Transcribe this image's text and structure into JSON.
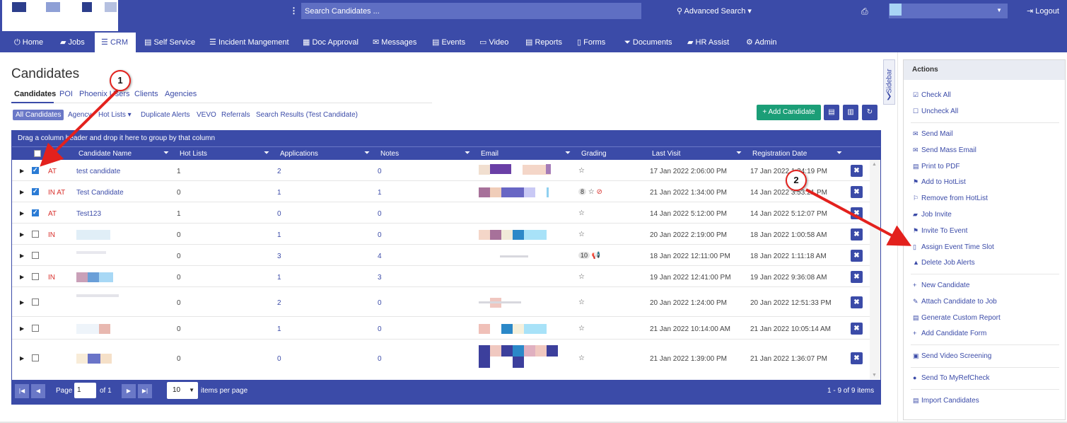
{
  "header": {
    "search_placeholder": "Search Candidates ...",
    "search_glyph": "⋮",
    "advanced_search": "Advanced Search",
    "logout": "Logout"
  },
  "nav": [
    {
      "label": "Home",
      "icon": "⏻"
    },
    {
      "label": "Jobs",
      "icon": "▰"
    },
    {
      "label": "CRM",
      "icon": "☰"
    },
    {
      "label": "Self Service",
      "icon": "▤"
    },
    {
      "label": "Incident Mangement",
      "icon": "☰"
    },
    {
      "label": "Doc Approval",
      "icon": "▦"
    },
    {
      "label": "Messages",
      "icon": "✉"
    },
    {
      "label": "Events",
      "icon": "▤"
    },
    {
      "label": "Video",
      "icon": "▭"
    },
    {
      "label": "Reports",
      "icon": "▤"
    },
    {
      "label": "Forms",
      "icon": "▯"
    },
    {
      "label": "Documents",
      "icon": "⏷"
    },
    {
      "label": "HR Assist",
      "icon": "▰"
    },
    {
      "label": "Admin",
      "icon": "⚙"
    }
  ],
  "page": {
    "title": "Candidates",
    "tabs": [
      "Candidates",
      "POI",
      "Phoenix Users",
      "Clients",
      "Agencies"
    ],
    "subtabs": [
      "All Candidates",
      "Agency",
      "Hot Lists ▾",
      "Duplicate Alerts",
      "VEVO",
      "Referrals",
      "Search Results (Test Candidate)"
    ],
    "add_candidate": "+ Add Candidate"
  },
  "grid": {
    "group_hint": "Drag a column header and drop it here to group by that column",
    "columns": [
      "Candidate Name",
      "Hot Lists",
      "Applications",
      "Notes",
      "Email",
      "Grading",
      "Last Visit",
      "Registration Date"
    ],
    "rows": [
      {
        "checked": true,
        "tag": "AT",
        "name": "test candidate",
        "hot": "1",
        "apps": "2",
        "notes": "0",
        "grade_count": "",
        "grade_extra": "",
        "last": "17 Jan 2022 2:06:00 PM",
        "reg": "17 Jan 2022 1:34:19 PM"
      },
      {
        "checked": true,
        "tag": "IN AT",
        "name": "Test Candidate",
        "hot": "0",
        "apps": "1",
        "notes": "1",
        "grade_count": "8",
        "grade_extra": "⊘",
        "last": "21 Jan 2022 1:34:00 PM",
        "reg": "14 Jan 2022 3:53:21 PM"
      },
      {
        "checked": true,
        "tag": "AT",
        "name": "Test123",
        "hot": "1",
        "apps": "0",
        "notes": "0",
        "grade_count": "",
        "grade_extra": "",
        "last": "14 Jan 2022 5:12:00 PM",
        "reg": "14 Jan 2022 5:12:07 PM"
      },
      {
        "checked": false,
        "tag": "IN",
        "name": "",
        "hot": "0",
        "apps": "1",
        "notes": "0",
        "grade_count": "",
        "grade_extra": "",
        "last": "20 Jan 2022 2:19:00 PM",
        "reg": "18 Jan 2022 1:00:58 AM"
      },
      {
        "checked": false,
        "tag": "",
        "name": "",
        "hot": "0",
        "apps": "3",
        "notes": "4",
        "grade_count": "10",
        "grade_extra": "📢",
        "last": "18 Jan 2022 12:11:00 PM",
        "reg": "18 Jan 2022 1:11:18 AM"
      },
      {
        "checked": false,
        "tag": "IN",
        "name": "",
        "hot": "0",
        "apps": "1",
        "notes": "3",
        "grade_count": "",
        "grade_extra": "",
        "last": "19 Jan 2022 12:41:00 PM",
        "reg": "19 Jan 2022 9:36:08 AM"
      },
      {
        "checked": false,
        "tag": "",
        "name": "",
        "hot": "0",
        "apps": "2",
        "notes": "0",
        "grade_count": "",
        "grade_extra": "",
        "last": "20 Jan 2022 1:24:00 PM",
        "reg": "20 Jan 2022 12:51:33 PM"
      },
      {
        "checked": false,
        "tag": "",
        "name": "",
        "hot": "0",
        "apps": "1",
        "notes": "0",
        "grade_count": "",
        "grade_extra": "",
        "last": "21 Jan 2022 10:14:00 AM",
        "reg": "21 Jan 2022 10:05:14 AM"
      },
      {
        "checked": false,
        "tag": "",
        "name": "",
        "hot": "0",
        "apps": "0",
        "notes": "0",
        "grade_count": "",
        "grade_extra": "",
        "last": "21 Jan 2022 1:39:00 PM",
        "reg": "21 Jan 2022 1:36:07 PM"
      }
    ],
    "pager": {
      "page_label": "Page",
      "page": "1",
      "of": "of 1",
      "per_page": "10",
      "per_page_label": "items per page",
      "summary": "1 - 9 of 9 items"
    }
  },
  "sidebar_toggle": "Sidebar",
  "actions": {
    "title": "Actions",
    "items": [
      {
        "label": "Check All",
        "icon": "☑"
      },
      {
        "label": "Uncheck All",
        "icon": "☐"
      },
      {
        "label": "Send Mail",
        "icon": "✉"
      },
      {
        "label": "Send Mass Email",
        "icon": "✉"
      },
      {
        "label": "Print to PDF",
        "icon": "▤"
      },
      {
        "label": "Add to HotList",
        "icon": "⚑"
      },
      {
        "label": "Remove from HotList",
        "icon": "⚐"
      },
      {
        "label": "Job Invite",
        "icon": "▰"
      },
      {
        "label": "Invite To Event",
        "icon": "⚑"
      },
      {
        "label": "Assign Event Time Slot",
        "icon": "▯"
      },
      {
        "label": "Delete Job Alerts",
        "icon": "▲"
      },
      {
        "label": "New Candidate",
        "icon": "+"
      },
      {
        "label": "Attach Candidate to Job",
        "icon": "✎"
      },
      {
        "label": "Generate Custom Report",
        "icon": "▤"
      },
      {
        "label": "Add Candidate Form",
        "icon": "+"
      },
      {
        "label": "Send Video Screening",
        "icon": "▣"
      },
      {
        "label": "Send To MyRefCheck",
        "icon": "●"
      },
      {
        "label": "Import Candidates",
        "icon": "▤"
      }
    ]
  },
  "annotations": [
    "1",
    "2"
  ],
  "colors": {
    "primary": "#3b4ba8",
    "success": "#1b9e77",
    "danger": "#d9302c",
    "annotation": "#e3211d"
  }
}
